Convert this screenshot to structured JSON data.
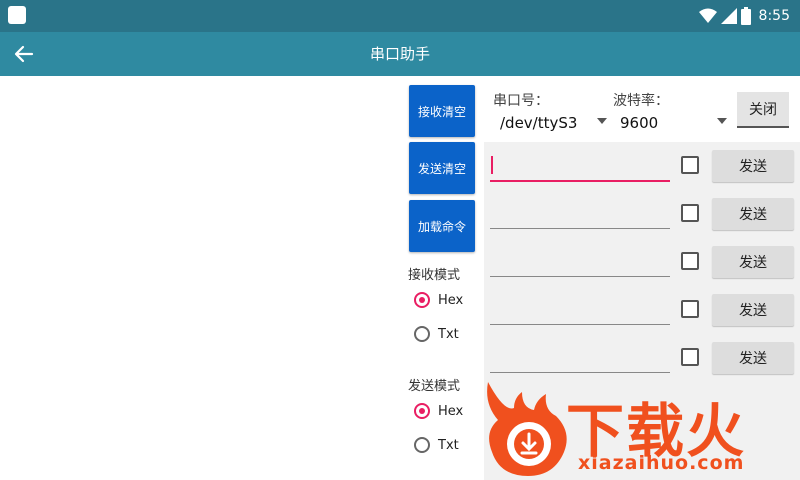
{
  "status_bar": {
    "time": "8:55",
    "icons": [
      "square-notification-icon",
      "wifi-icon",
      "signal-icon",
      "battery-icon"
    ]
  },
  "app_bar": {
    "title": "串口助手",
    "back_icon": "arrow-left-icon"
  },
  "left_panel": {
    "buttons": [
      {
        "label": "接收清空"
      },
      {
        "label": "发送清空"
      },
      {
        "label": "加载命令"
      }
    ],
    "receive_mode": {
      "label": "接收模式",
      "options": [
        {
          "label": "Hex",
          "selected": true
        },
        {
          "label": "Txt",
          "selected": false
        }
      ]
    },
    "send_mode": {
      "label": "发送模式",
      "options": [
        {
          "label": "Hex",
          "selected": true
        },
        {
          "label": "Txt",
          "selected": false
        }
      ]
    }
  },
  "port": {
    "port_label": "串口号：",
    "port_value": "/dev/ttyS3",
    "baud_label": "波特率：",
    "baud_value": "9600",
    "close_label": "关闭"
  },
  "send_rows": [
    {
      "value": "",
      "checked": false,
      "button": "发送",
      "focused": true
    },
    {
      "value": "",
      "checked": false,
      "button": "发送",
      "focused": false
    },
    {
      "value": "",
      "checked": false,
      "button": "发送",
      "focused": false
    },
    {
      "value": "",
      "checked": false,
      "button": "发送",
      "focused": false
    },
    {
      "value": "",
      "checked": false,
      "button": "发送",
      "focused": false
    }
  ],
  "watermark": {
    "text": "下载火",
    "url": "xiazaihuo.com"
  },
  "colors": {
    "status_bar": "#2a7489",
    "app_bar": "#2f8aa1",
    "primary_button": "#0b63c9",
    "accent": "#e91e63",
    "watermark": "#f0501e"
  }
}
